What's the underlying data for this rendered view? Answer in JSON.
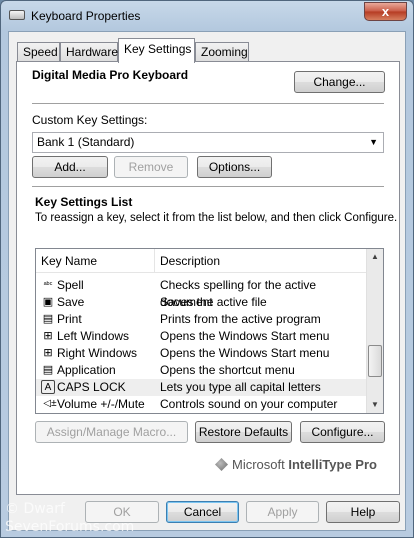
{
  "window": {
    "title": "Keyboard Properties",
    "close_symbol": "x",
    "icon": "keyboard-icon"
  },
  "tabs": [
    {
      "label": "Speed",
      "active": false
    },
    {
      "label": "Hardware",
      "active": false
    },
    {
      "label": "Key Settings",
      "active": true
    },
    {
      "label": "Zooming",
      "active": false
    }
  ],
  "keyboard": {
    "name": "Digital Media Pro Keyboard",
    "change_label": "Change..."
  },
  "custom": {
    "label": "Custom Key Settings:",
    "selected": "Bank 1 (Standard)",
    "add_label": "Add...",
    "remove_label": "Remove",
    "options_label": "Options..."
  },
  "list": {
    "heading": "Key Settings List",
    "instructions": "To reassign a key, select it from the list below, and then click Configure.",
    "columns": [
      "Key Name",
      "Description"
    ],
    "rows": [
      {
        "icon": "abc-icon",
        "glyph": "ᵃᵇᶜ",
        "name": "Spell",
        "desc": "Checks spelling for the active document",
        "selected": false
      },
      {
        "icon": "save-icon",
        "glyph": "▣",
        "name": "Save",
        "desc": "Saves the active file",
        "selected": false
      },
      {
        "icon": "print-icon",
        "glyph": "▤",
        "name": "Print",
        "desc": "Prints from the active program",
        "selected": false
      },
      {
        "icon": "windows-logo-icon",
        "glyph": "⊞",
        "name": "Left Windows",
        "desc": "Opens the Windows Start menu",
        "selected": false
      },
      {
        "icon": "windows-logo-icon",
        "glyph": "⊞",
        "name": "Right Windows",
        "desc": "Opens the Windows Start menu",
        "selected": false
      },
      {
        "icon": "menu-icon",
        "glyph": "▤",
        "name": "Application",
        "desc": "Opens the shortcut menu",
        "selected": false
      },
      {
        "icon": "caps-lock-icon",
        "glyph": "A",
        "name": "CAPS LOCK",
        "desc": "Lets you type all capital letters",
        "selected": true
      },
      {
        "icon": "speaker-icon",
        "glyph": "◁±",
        "name": "Volume +/-/Mute",
        "desc": "Controls sound on your computer",
        "selected": false
      }
    ]
  },
  "actions": {
    "assign_label": "Assign/Manage Macro...",
    "restore_label": "Restore Defaults",
    "configure_label": "Configure..."
  },
  "logo": {
    "brand": "Microsoft",
    "product": "IntelliType Pro"
  },
  "dialog_buttons": {
    "ok": "OK",
    "cancel": "Cancel",
    "apply": "Apply",
    "help": "Help"
  },
  "watermark": {
    "line1": "© Dwarf",
    "line2": "SevenForums.com"
  }
}
